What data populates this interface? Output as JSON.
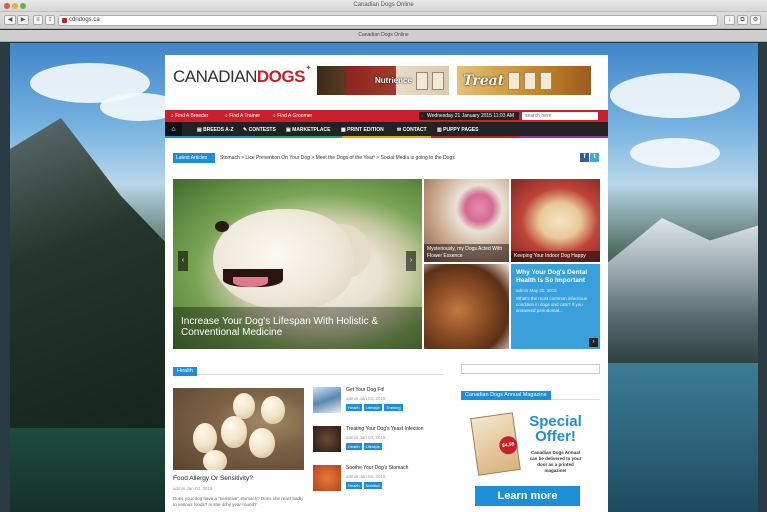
{
  "window": {
    "title": "Canadian Dogs Online",
    "tab_title": "Canadian Dogs Online"
  },
  "toolbar": {
    "url": "cdndogs.ca",
    "back": "◀",
    "forward": "▶"
  },
  "site": {
    "logo_light": "CANADIAN",
    "logo_bold": "DOGS",
    "ads": {
      "nutrience": "Nutrience",
      "treat": "Treat"
    },
    "topbar": {
      "links": [
        "Find A Breeder",
        "Find A Trainer",
        "Find A Groomer"
      ],
      "date": "Wednesday 21 January 2015 11:03 AM",
      "search_placeholder": "search here"
    },
    "nav": [
      "BREEDS A-Z",
      "CONTESTS",
      "MARKETPLACE",
      "PRINT EDITION",
      "CONTACT",
      "PUPPY PAGES"
    ],
    "ticker": {
      "label": "Latest Articles",
      "items": "Stomach  >  Lice Prevention On Your Dog  >  Meet the Dogs of the Year!  >  Social Media is going to the Dogs"
    },
    "slider": {
      "caption": "Increase Your Dog's Lifespan With Holistic & Conventional Medicine"
    },
    "tiles": {
      "t1": "Mysteriously, my Dogs Acted With Flower Essence",
      "t2": "Keeping Your Indoor Dog Happy",
      "t4_title": "Why Your Dog's Dental Health Is So Important",
      "t4_meta": "admin  May 30, 2015",
      "t4_body": "What's the most common infectious condition in dogs and cats? If you answered periodontal..."
    },
    "health": {
      "label": "Health",
      "feature_title": "Food Allergy Or Sensitivity?",
      "feature_meta": "admin  Jan 03, 2015",
      "feature_body": "Does your dog have a \"sensitive\" stomach? Does she react badly to various foods? Is she itchy year-round?",
      "items": [
        {
          "title": "Get Your Dog Fit!",
          "meta": "admin  Jan 03, 2015",
          "tags": [
            "Health",
            "Lifestyle",
            "Training"
          ]
        },
        {
          "title": "Treating Your Dog's Yeast Infection",
          "meta": "admin  Jan 03, 2015",
          "tags": [
            "Health",
            "Lifestyle"
          ]
        },
        {
          "title": "Soothe Your Dog's Stomach",
          "meta": "admin  Jan 03, 2015",
          "tags": [
            "Health",
            "Nutrition"
          ]
        }
      ]
    },
    "sidebar": {
      "label": "Canadian Dogs Annual Magazine",
      "special": "Special Offer!",
      "special_sub": "Canadian Dogs Annual can be delivered to your door as a printed magazine!",
      "price": "$4.95",
      "button": "Learn more"
    }
  }
}
